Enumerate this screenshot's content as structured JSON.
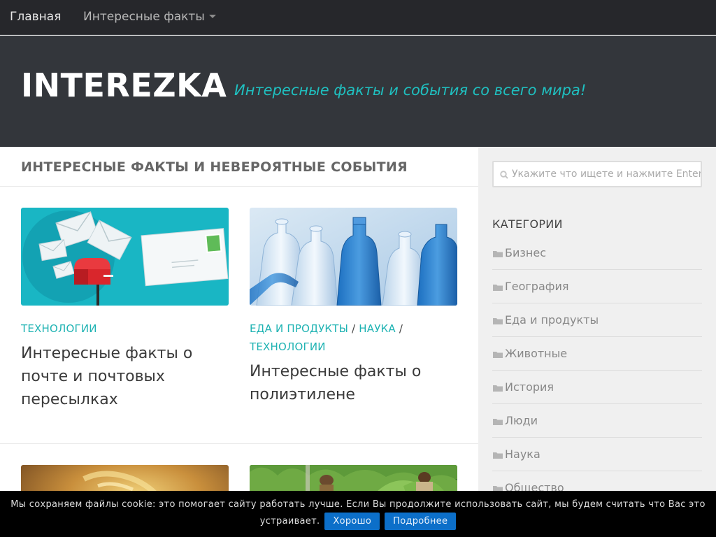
{
  "nav": {
    "home": "Главная",
    "facts": "Интересные факты"
  },
  "header": {
    "site_title": "INTEREZKA",
    "site_description": "Интересные факты и события со всего мира!"
  },
  "main": {
    "page_title": "ИНТЕРЕСНЫЕ ФАКТЫ И НЕВЕРОЯТНЫЕ СОБЫТИЯ",
    "posts": [
      {
        "categories": [
          "ТЕХНОЛОГИИ"
        ],
        "title": "Интересные факты о почте и почтовых пересылках",
        "image": "mail-envelopes-illustration"
      },
      {
        "categories": [
          "ЕДА И ПРОДУКТЫ",
          "НАУКА",
          "ТЕХНОЛОГИИ"
        ],
        "title": "Интересные факты о полиэтилене",
        "image": "plastic-bottles-photo"
      },
      {
        "categories": [],
        "title": "",
        "image": "pasta-food-photo"
      },
      {
        "categories": [],
        "title": "",
        "image": "jungle-people-photo"
      }
    ],
    "category_separator": " / "
  },
  "sidebar": {
    "search_placeholder": "Укажите что ищете и нажмите Enter",
    "categories_title": "КАТЕГОРИИ",
    "categories": [
      "Бизнес",
      "География",
      "Еда и продукты",
      "Животные",
      "История",
      "Люди",
      "Наука",
      "Общество"
    ]
  },
  "cookie": {
    "text": "Мы сохраняем файлы cookie: это помогает сайту работать лучше. Если Вы продолжите использовать сайт, мы будем считать что Вас это устраивает.",
    "accept_label": "Хорошо",
    "more_label": "Подробнее"
  },
  "colors": {
    "accent": "#1fb3b3",
    "header_bg": "#33363b",
    "nav_bg": "#26272b",
    "cookie_button": "#0c6fc9"
  }
}
